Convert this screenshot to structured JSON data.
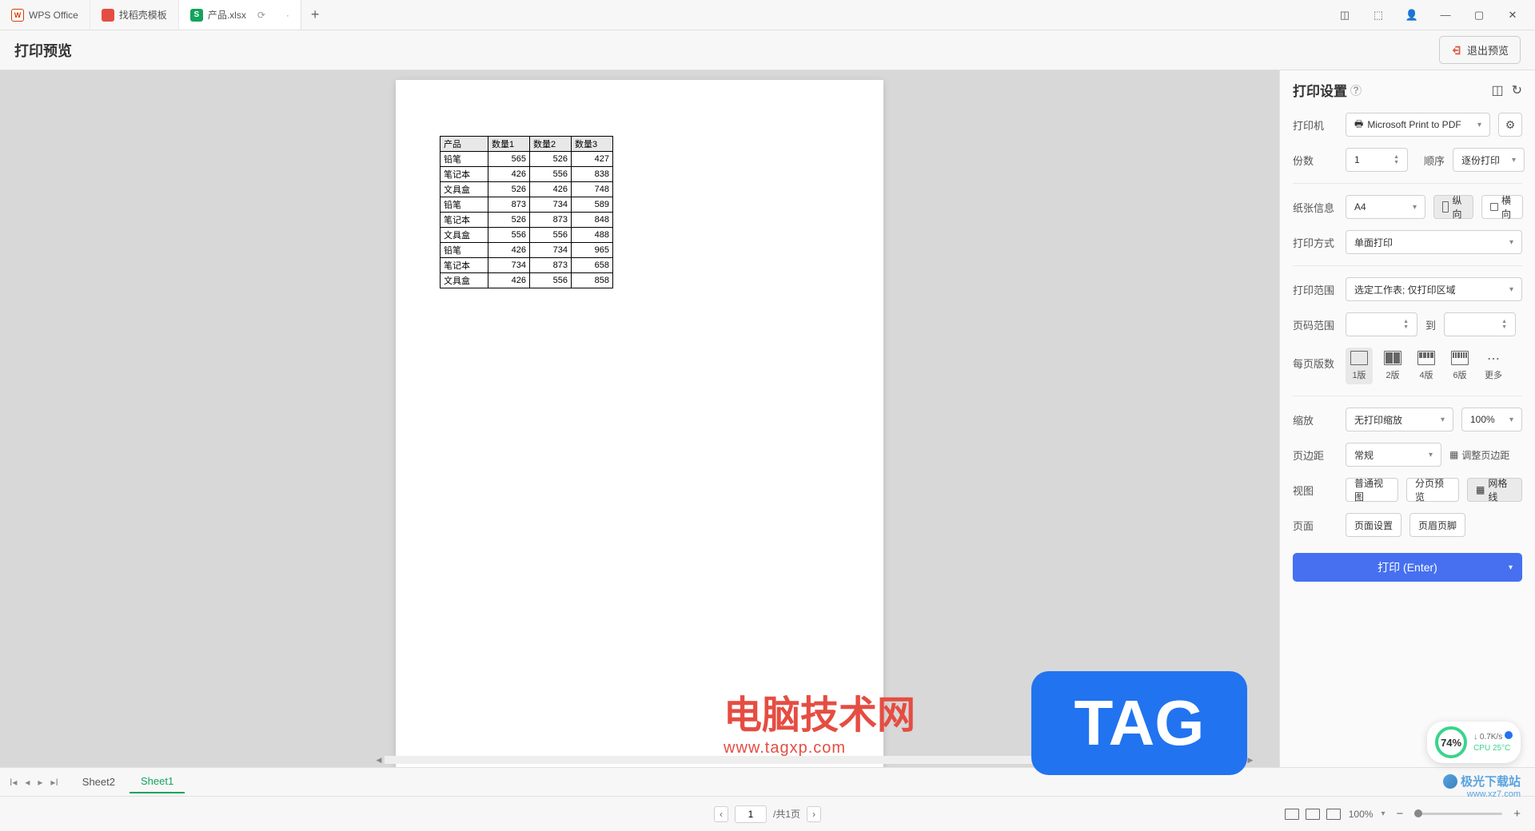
{
  "titleBar": {
    "tab1": "WPS Office",
    "tab2": "找稻壳模板",
    "tab3": "产品.xlsx"
  },
  "header": {
    "title": "打印预览",
    "exitButton": "退出预览"
  },
  "table": {
    "headers": [
      "产品",
      "数量1",
      "数量2",
      "数量3"
    ],
    "rows": [
      [
        "铅笔",
        "565",
        "526",
        "427"
      ],
      [
        "笔记本",
        "426",
        "556",
        "838"
      ],
      [
        "文具盒",
        "526",
        "426",
        "748"
      ],
      [
        "铅笔",
        "873",
        "734",
        "589"
      ],
      [
        "笔记本",
        "526",
        "873",
        "848"
      ],
      [
        "文具盒",
        "556",
        "556",
        "488"
      ],
      [
        "铅笔",
        "426",
        "734",
        "965"
      ],
      [
        "笔记本",
        "734",
        "873",
        "658"
      ],
      [
        "文具盒",
        "426",
        "556",
        "858"
      ]
    ]
  },
  "settings": {
    "panelTitle": "打印设置",
    "printerLabel": "打印机",
    "printerValue": "Microsoft Print to PDF",
    "copiesLabel": "份数",
    "copiesValue": "1",
    "orderLabel": "顺序",
    "orderValue": "逐份打印",
    "paperLabel": "纸张信息",
    "paperValue": "A4",
    "portraitLabel": "纵向",
    "landscapeLabel": "横向",
    "methodLabel": "打印方式",
    "methodValue": "单面打印",
    "rangeLabel": "打印范围",
    "rangeValue": "选定工作表; 仅打印区域",
    "pageRangeLabel": "页码范围",
    "toLabel": "到",
    "perPageLabel": "每页版数",
    "l1": "1版",
    "l2": "2版",
    "l4": "4版",
    "l6": "6版",
    "lmore": "更多",
    "zoomLabel": "缩放",
    "zoomValue": "无打印缩放",
    "zoomPct": "100%",
    "marginLabel": "页边距",
    "marginValue": "常规",
    "adjustMargin": "调整页边距",
    "viewLabel": "视图",
    "viewNormal": "普通视图",
    "viewSplit": "分页预览",
    "viewGrid": "网格线",
    "pageLabel": "页面",
    "pageSetup": "页面设置",
    "headerFooter": "页眉页脚",
    "printButton": "打印 (Enter)"
  },
  "sheets": {
    "sheet2": "Sheet2",
    "sheet1": "Sheet1"
  },
  "statusBar": {
    "pageInput": "1",
    "pageTotal": "/共1页",
    "zoom": "100%"
  },
  "watermarks": {
    "title": "电脑技术网",
    "url": "www.tagxp.com",
    "badge": "TAG",
    "cpu": "74%",
    "net": "0.7K/s",
    "temp": "CPU 25°C",
    "dlName": "极光下载站",
    "dlUrl": "www.xz7.com"
  }
}
